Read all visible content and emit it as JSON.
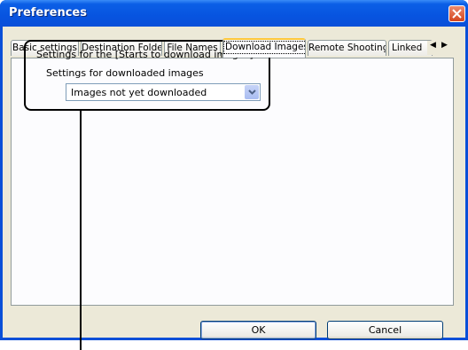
{
  "window": {
    "title": "Preferences"
  },
  "tabs": [
    {
      "label": "Basic settings"
    },
    {
      "label": "Destination Folder"
    },
    {
      "label": "File Names"
    },
    {
      "label": "Download Images"
    },
    {
      "label": "Remote Shooting"
    },
    {
      "label": "Linked"
    }
  ],
  "settings": {
    "group_label": "Settings for the [Starts to download images] button",
    "sub_label": "Settings for downloaded images",
    "select_value": "Images not yet downloaded"
  },
  "buttons": {
    "ok": "OK",
    "cancel": "Cancel"
  },
  "colors": {
    "titlebar": "#0a4fd8",
    "client": "#ece9d8",
    "active_tab_accent": "#ffc83c"
  }
}
